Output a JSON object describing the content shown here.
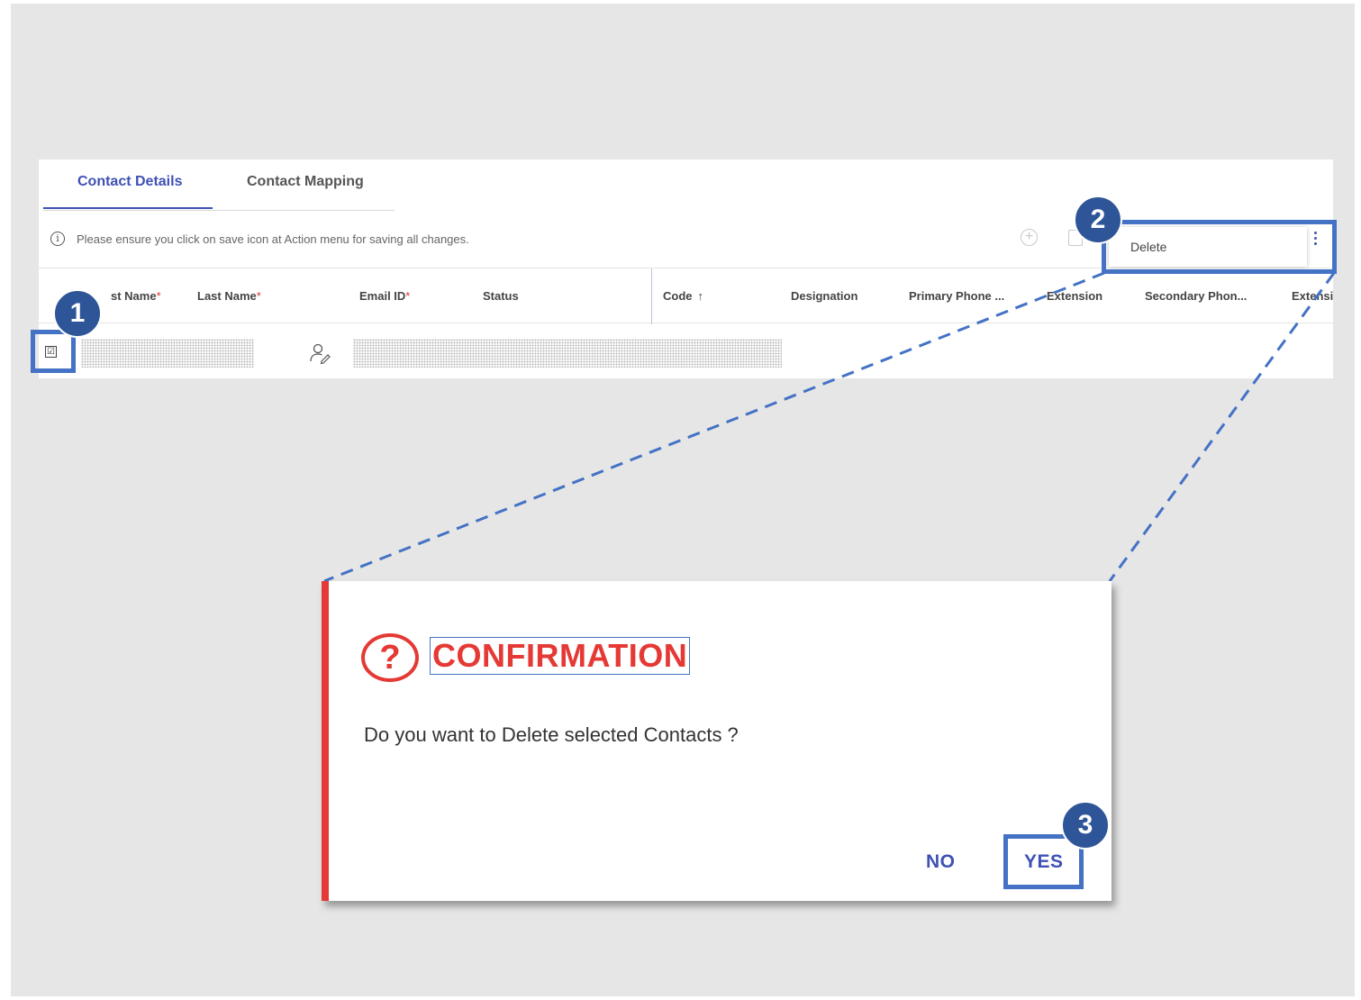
{
  "tabs": [
    {
      "label": "Contact Details",
      "active": true
    },
    {
      "label": "Contact Mapping",
      "active": false
    }
  ],
  "info_message": "Please ensure you click on save icon at Action menu for saving all changes.",
  "action_menu": {
    "delete_label": "Delete"
  },
  "table": {
    "columns": [
      {
        "label": "st Name",
        "required": true
      },
      {
        "label": "Last Name",
        "required": true
      },
      {
        "label": "Email ID",
        "required": true
      },
      {
        "label": "Status",
        "required": false
      },
      {
        "label": "Code",
        "sorted": "ascending"
      },
      {
        "label": "Designation"
      },
      {
        "label": "Primary Phone ..."
      },
      {
        "label": "Extension"
      },
      {
        "label": "Secondary Phon..."
      },
      {
        "label": "Extensi"
      }
    ],
    "sort_arrow": "↑",
    "required_mark": "*",
    "row_checked_glyph": "☑"
  },
  "callouts": {
    "step1": "1",
    "step2": "2",
    "step3": "3"
  },
  "dialog": {
    "icon": "?",
    "title": "CONFIRMATION",
    "message": "Do you want to Delete selected Contacts ?",
    "no_label": "NO",
    "yes_label": "YES"
  },
  "colors": {
    "accent": "#3f51b5",
    "callout": "#4472c4",
    "badge": "#2e5597",
    "danger": "#e53935",
    "background": "#e6e6e6"
  }
}
